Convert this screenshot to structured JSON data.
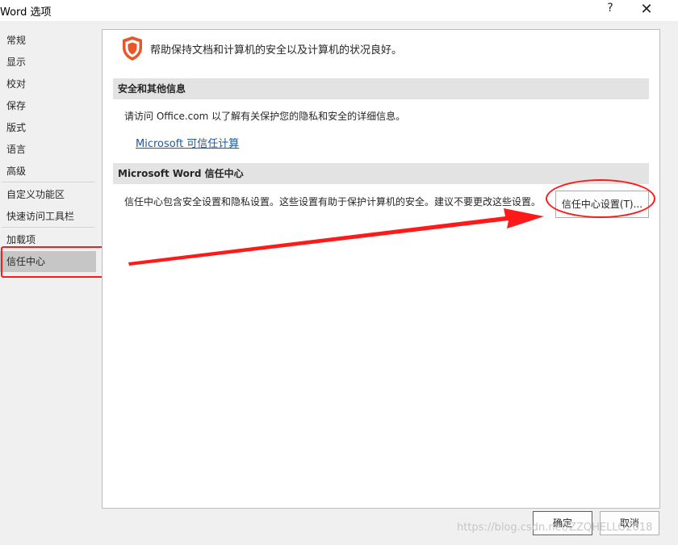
{
  "window": {
    "title": "Word 选项",
    "help_glyph": "?",
    "close_glyph": "✕"
  },
  "sidebar": {
    "items": [
      {
        "label": "常规"
      },
      {
        "label": "显示"
      },
      {
        "label": "校对"
      },
      {
        "label": "保存"
      },
      {
        "label": "版式"
      },
      {
        "label": "语言"
      },
      {
        "label": "高级"
      },
      {
        "label": "自定义功能区"
      },
      {
        "label": "快速访问工具栏"
      },
      {
        "label": "加载项"
      },
      {
        "label": "信任中心",
        "selected": true
      }
    ]
  },
  "main": {
    "header_text": "帮助保持文档和计算机的安全以及计算机的状况良好。",
    "shield_icon": "shield-icon",
    "section1": {
      "title": "安全和其他信息",
      "text": "请访问 Office.com 以了解有关保护您的隐私和安全的详细信息。",
      "link": "Microsoft 可信任计算"
    },
    "section2": {
      "title": "Microsoft Word 信任中心",
      "text": "信任中心包含安全设置和隐私设置。这些设置有助于保护计算机的安全。建议不要更改这些设置。",
      "button": "信任中心设置(T)..."
    }
  },
  "footer": {
    "ok": "确定",
    "cancel": "取消"
  },
  "watermark": "https://blog.csdn.net/ZZQHELLO2018",
  "colors": {
    "annotation_red": "#ff1a1a",
    "selected_bg": "#c6c6c6",
    "shield": "#e8562a",
    "link": "#1a5aa6"
  }
}
